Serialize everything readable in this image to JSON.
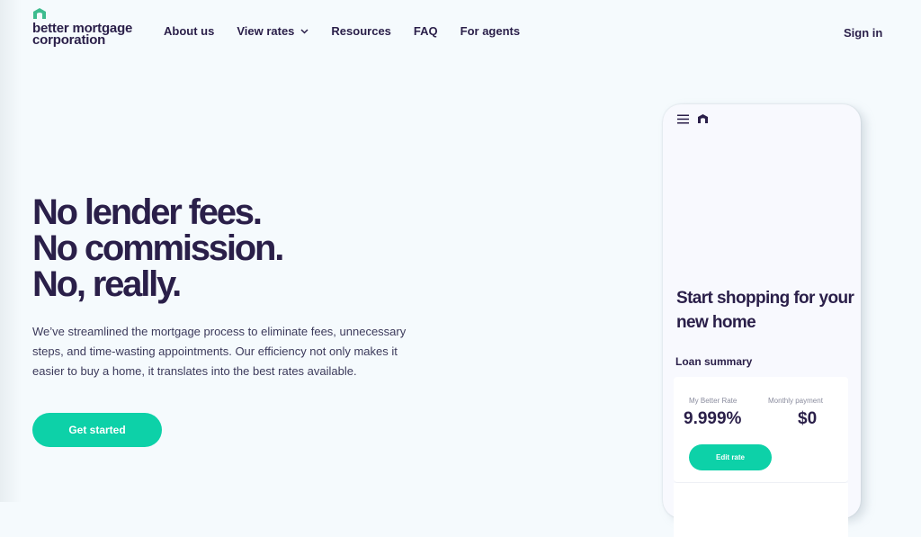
{
  "brand": {
    "name_line1": "better mortgage",
    "name_line2": "corporation",
    "logo_icon": "house-arch-icon",
    "accent_color": "#0dd1a8",
    "text_color": "#2a1f49"
  },
  "nav": {
    "items": [
      {
        "label": "About us",
        "has_dropdown": false
      },
      {
        "label": "View rates",
        "has_dropdown": true
      },
      {
        "label": "Resources",
        "has_dropdown": false
      },
      {
        "label": "FAQ",
        "has_dropdown": false
      },
      {
        "label": "For agents",
        "has_dropdown": false
      }
    ],
    "sign_in": "Sign in"
  },
  "hero": {
    "headline": [
      "No lender fees.",
      "No commission.",
      "No, really."
    ],
    "body": "We’ve streamlined the mortgage process to eliminate fees, unnecessary steps, and time-wasting appointments. Our efficiency not only makes it easier to buy a home, it translates into the best rates available.",
    "cta_label": "Get started"
  },
  "phone": {
    "menu_icon": "hamburger-menu-icon",
    "title": "Start shopping for your new home",
    "loan_summary_label": "Loan summary",
    "rate_label": "My Better Rate",
    "rate_value": "9.999%",
    "payment_label": "Monthly payment",
    "payment_value": "$0",
    "edit_label": "Edit rate"
  }
}
